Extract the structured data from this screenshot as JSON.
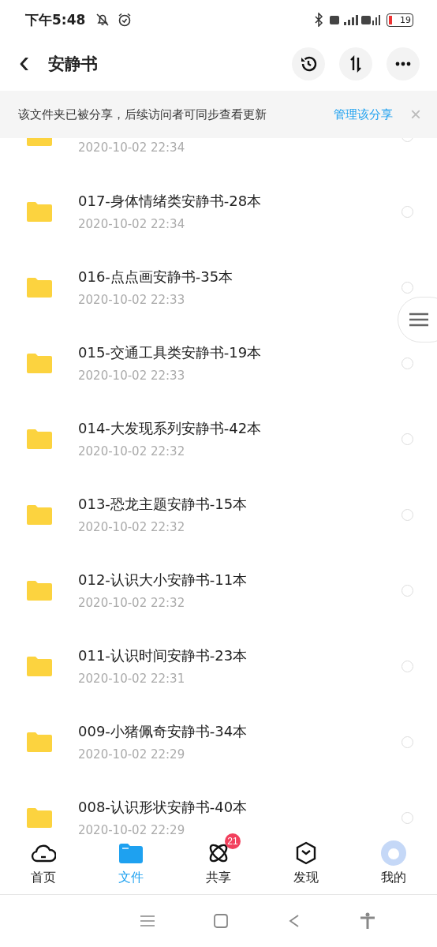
{
  "status_bar": {
    "time": "下午5:48",
    "battery": "19"
  },
  "header": {
    "back": "‹",
    "title": "安静书"
  },
  "share_banner": {
    "text": "该文件夹已被分享，后续访问者可同步查看更新",
    "link": "管理该分享",
    "close": "×"
  },
  "folders": [
    {
      "date": "2020-10-02  22:34",
      "selected": false
    },
    {
      "name": "017-身体情绪类安静书-28本",
      "date": "2020-10-02  22:34",
      "selected": false
    },
    {
      "name": "016-点点画安静书-35本",
      "date": "2020-10-02  22:33",
      "selected": false
    },
    {
      "name": "015-交通工具类安静书-19本",
      "date": "2020-10-02  22:33",
      "selected": false
    },
    {
      "name": "014-大发现系列安静书-42本",
      "date": "2020-10-02  22:32",
      "selected": false
    },
    {
      "name": "013-恐龙主题安静书-15本",
      "date": "2020-10-02  22:32",
      "selected": false
    },
    {
      "name": "012-认识大小安静书-11本",
      "date": "2020-10-02  22:32",
      "selected": false
    },
    {
      "name": "011-认识时间安静书-23本",
      "date": "2020-10-02  22:31",
      "selected": false
    },
    {
      "name": "009-小猪佩奇安静书-34本",
      "date": "2020-10-02  22:29",
      "selected": false
    },
    {
      "name": "008-认识形状安静书-40本",
      "date": "2020-10-02  22:29",
      "selected": false
    }
  ],
  "tabs": [
    {
      "kind": "home",
      "label": "首页",
      "selected": false
    },
    {
      "kind": "files",
      "label": "文件",
      "selected": true
    },
    {
      "kind": "share",
      "label": "共享",
      "selected": false,
      "badge": "21"
    },
    {
      "kind": "discover",
      "label": "发现",
      "selected": false
    },
    {
      "kind": "me",
      "label": "我的",
      "selected": false
    }
  ]
}
